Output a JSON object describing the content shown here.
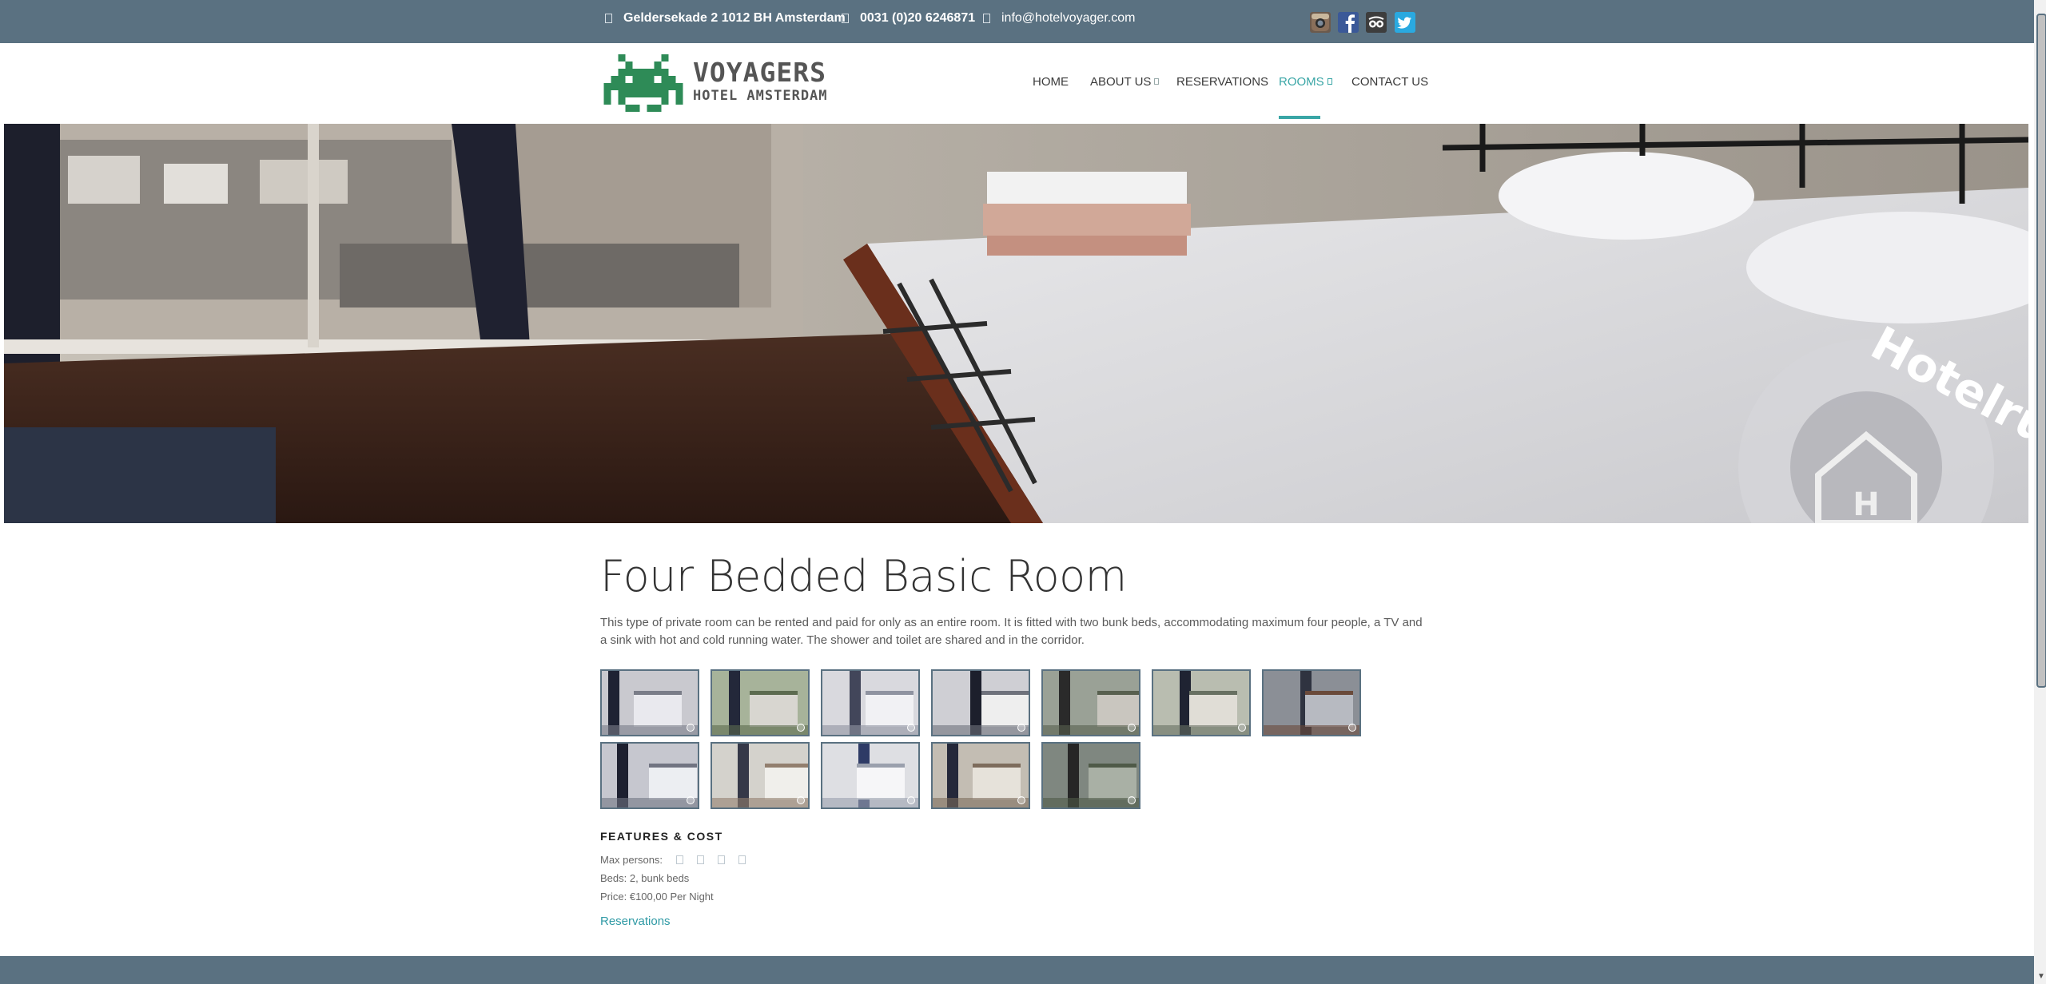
{
  "topbar": {
    "address": "Geldersekade 2 1012 BH Amsterdam",
    "phone": "0031 (0)20 6246871",
    "email": "info@hotelvoyager.com",
    "social": [
      "instagram-icon",
      "facebook-icon",
      "tripadvisor-icon",
      "twitter-icon"
    ]
  },
  "logo": {
    "line1": "VOYAGERS",
    "line2": "HOTEL AMSTERDAM"
  },
  "nav": {
    "items": [
      {
        "label": "HOME"
      },
      {
        "label": "ABOUT US"
      },
      {
        "label": "RESERVATIONS"
      },
      {
        "label": "ROOMS"
      },
      {
        "label": "CONTACT US"
      }
    ],
    "active": "ROOMS"
  },
  "hero": {
    "watermark": "Hotelrun"
  },
  "room": {
    "title": "Four Bedded Basic Room",
    "description": "This type of private room can be rented and paid for only as an entire room. It is fitted with two bunk beds, accommodating maximum four people, a TV and a sink with hot and cold running water. The shower and toilet are shared and in the corridor.",
    "gallery_count": 12
  },
  "features": {
    "heading": "FEATURES & COST",
    "max_persons_label": "Max persons:",
    "max_persons": 4,
    "beds": "Beds: 2, bunk beds",
    "price": "Price: €100,00 Per Night",
    "reservations_link": "Reservations"
  },
  "colors": {
    "topbar": "#5a7181",
    "accent": "#3aa6a6",
    "logo_green": "#2e8b57",
    "link": "#2f9aa5"
  }
}
